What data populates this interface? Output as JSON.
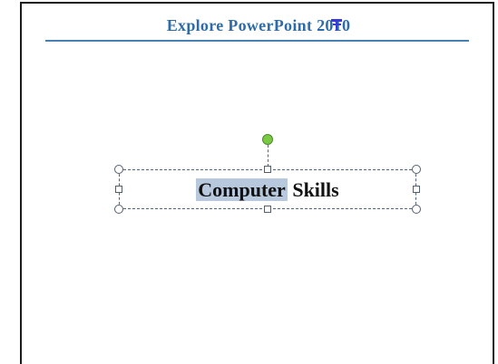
{
  "slide": {
    "title": "Explore PowerPoint 2010",
    "textbox": {
      "highlighted_word": "Computer",
      "rest_text": "Skills"
    }
  },
  "colors": {
    "title": "#2e6ca8",
    "rule": "#4a7fb4",
    "selection_highlight": "#b9c9dd",
    "rotate_handle": "#7ac943",
    "dashed_border": "#506582"
  },
  "icons": {
    "cursor": "text-insertion-cursor-icon"
  }
}
